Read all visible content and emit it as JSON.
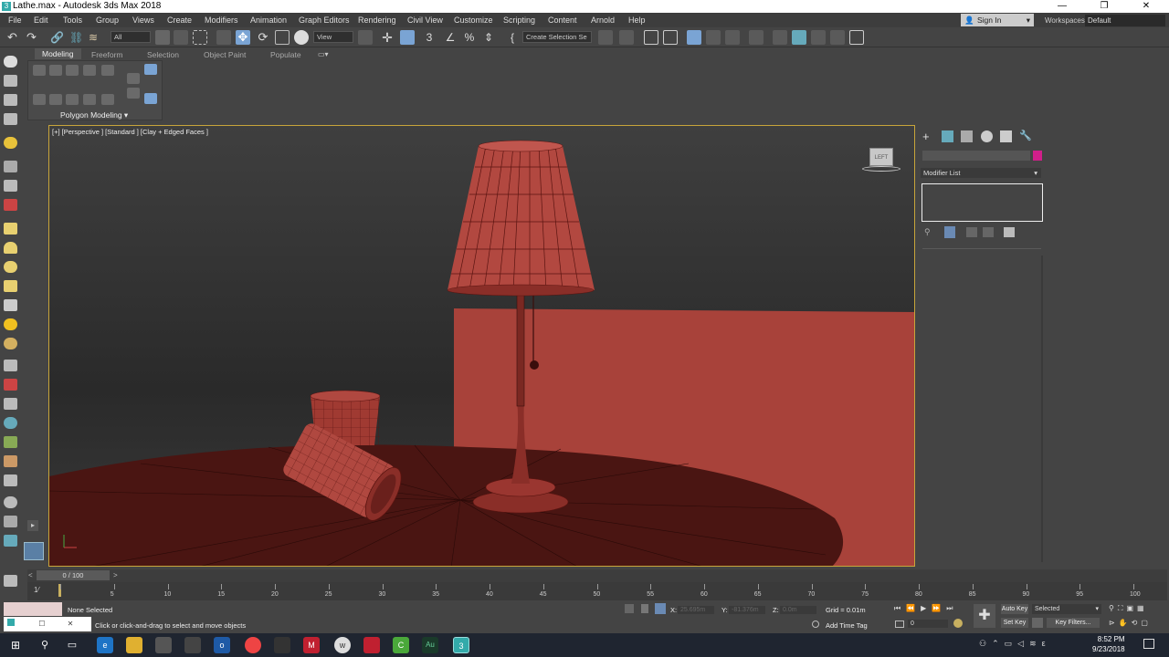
{
  "window": {
    "title": "Lathe.max - Autodesk 3ds Max 2018",
    "minimize": "—",
    "maximize": "❐",
    "close": "✕"
  },
  "menu": [
    "File",
    "Edit",
    "Tools",
    "Group",
    "Views",
    "Create",
    "Modifiers",
    "Animation",
    "Graph Editors",
    "Rendering",
    "Civil View",
    "Customize",
    "Scripting",
    "Content",
    "Arnold",
    "Help"
  ],
  "account": {
    "signin": "Sign In",
    "workspaces_label": "Workspaces:",
    "workspace_value": "Default"
  },
  "toolbar": {
    "selection_filter": "All",
    "ref_coord": "View",
    "named_selection": "Create Selection Se"
  },
  "ribbon": {
    "tabs": [
      "Modeling",
      "Freeform",
      "Selection",
      "Object Paint",
      "Populate"
    ],
    "panel_label": "Polygon Modeling ▾"
  },
  "viewport": {
    "label": "[+] [Perspective ] [Standard ] [Clay + Edged Faces ]",
    "viewcube_label": "LEFT"
  },
  "command_panel": {
    "modifier_list": "Modifier List"
  },
  "timeline": {
    "frame_display": "0 / 100",
    "ticks": [
      "0",
      "5",
      "10",
      "15",
      "20",
      "25",
      "30",
      "35",
      "40",
      "45",
      "50",
      "55",
      "60",
      "65",
      "70",
      "75",
      "80",
      "85",
      "90",
      "95",
      "100"
    ]
  },
  "status": {
    "selection": "None Selected",
    "prompt": "Click or click-and-drag to select and move objects",
    "x_label": "X:",
    "x_value": "25.695m",
    "y_label": "Y:",
    "y_value": "-81.376m",
    "z_label": "Z:",
    "z_value": "0.0m",
    "grid": "Grid = 0.01m",
    "add_time_tag": "Add Time Tag",
    "auto_key": "Auto Key",
    "set_key": "Set Key",
    "selected": "Selected",
    "key_filters": "Key Filters...",
    "frame_field": "0"
  },
  "taskbar": {
    "time": "8:52 PM",
    "date": "9/23/2018"
  },
  "colors": {
    "viewport_border": "#c8a53a",
    "object_color": "#d01f8a",
    "model_red": "#a8423a"
  }
}
